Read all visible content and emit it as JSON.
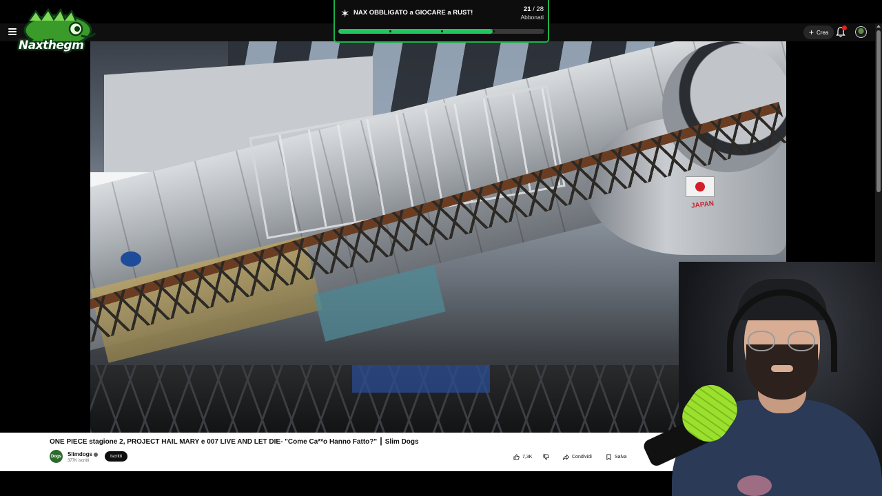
{
  "goal": {
    "title": "NAX OBBLIGATO a GIOCARE a RUST!",
    "current": "21",
    "separator": "/",
    "target": "28",
    "unit": "Abbonati",
    "progress": 0.75
  },
  "logo": {
    "text": "Naxthegm"
  },
  "youtube": {
    "create_label": "Crea",
    "video_title": "ONE PIECE stagione 2, PROJECT HAIL MARY e 007 LIVE AND LET DIE- \"Come Ca**o Hanno Fatto?\" ┃ Slim Dogs",
    "channel_name": "Slimdogs",
    "channel_initials": "Dogs",
    "channel_subs": "377K iscritti",
    "subscribe_label": "Iscritti",
    "likes": "7,3K",
    "share_label": "Condividi",
    "save_label": "Salva",
    "video_overlay_text": {
      "flag_label": "JAPAN"
    }
  },
  "colors": {
    "goal_accent": "#22c55e",
    "notification_badge": "#e62117",
    "youtube_bg": "#0f0f0f"
  },
  "icons": [
    "menu-icon",
    "plus-icon",
    "bell-icon",
    "avatar",
    "star-icon",
    "thumbs-up-icon",
    "thumbs-down-icon",
    "share-icon",
    "save-icon",
    "verified-icon"
  ]
}
